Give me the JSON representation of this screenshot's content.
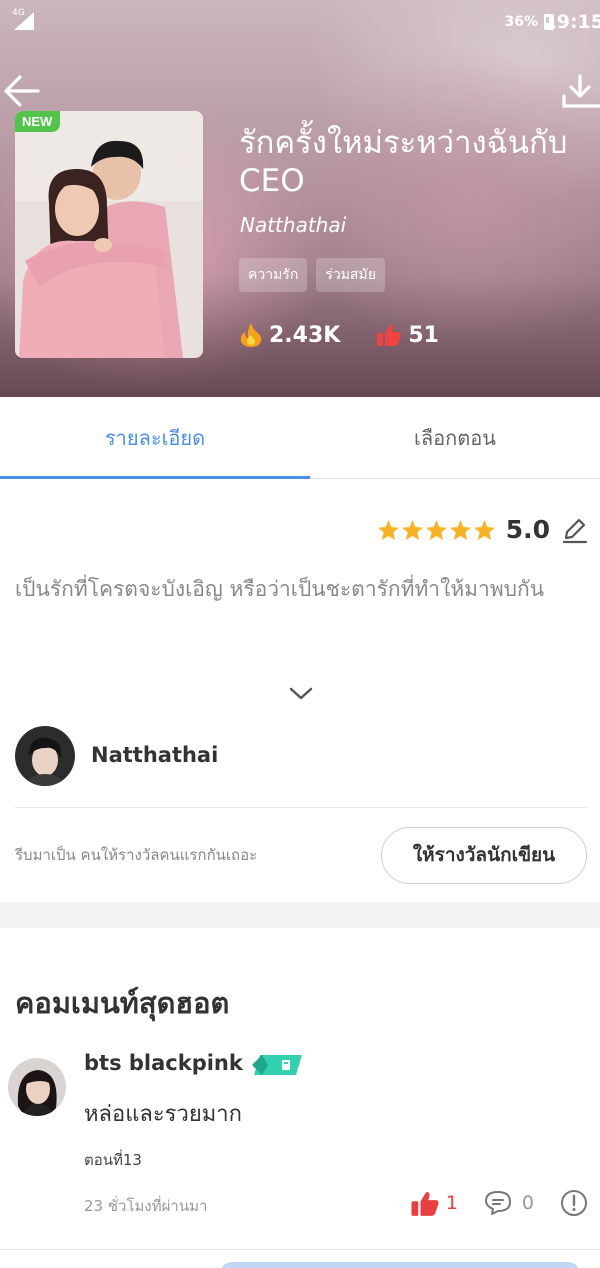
{
  "status_bar": {
    "network": "4G",
    "battery": "36%",
    "time": "19:15"
  },
  "book": {
    "badge": "NEW",
    "title": "รักครั้งใหม่ระหว่างฉันกับ CEO",
    "author": "Natthathai",
    "tags": [
      "ความรัก",
      "ร่วมสมัย"
    ],
    "views": "2.43K",
    "likes": "51",
    "icons": {
      "back": "back-arrow-icon",
      "download": "download-icon",
      "views": "fire-icon",
      "likes": "thumbs-up-icon"
    }
  },
  "tabs": [
    {
      "label": "รายละเอียด",
      "active": true
    },
    {
      "label": "เลือกตอน",
      "active": false
    }
  ],
  "rating": {
    "stars": 5,
    "value": "5.0",
    "star_color": "#f5b325"
  },
  "description": "เป็นรักที่โครตจะบังเอิญ หรือว่าเป็นชะตารักที่ทำให้มาพบกัน",
  "author_section": {
    "name": "Natthathai",
    "reward_prompt": "รีบมาเป็น คนให้รางวัลคนแรกกันเถอะ",
    "reward_button": "ให้รางวัลนักเขียน"
  },
  "comments": {
    "heading": "คอมเมนท์สุดฮอต",
    "items": [
      {
        "user": "bts blackpink",
        "text": "หล่อและรวยมาก",
        "chapter": "ตอนที่13",
        "time": "23 ชั่วโมงที่ผ่านมา",
        "likes": "1",
        "replies": "0"
      }
    ]
  },
  "colors": {
    "accent": "#4a90e2",
    "new_badge": "#53c34b",
    "like_red": "#e84040"
  }
}
